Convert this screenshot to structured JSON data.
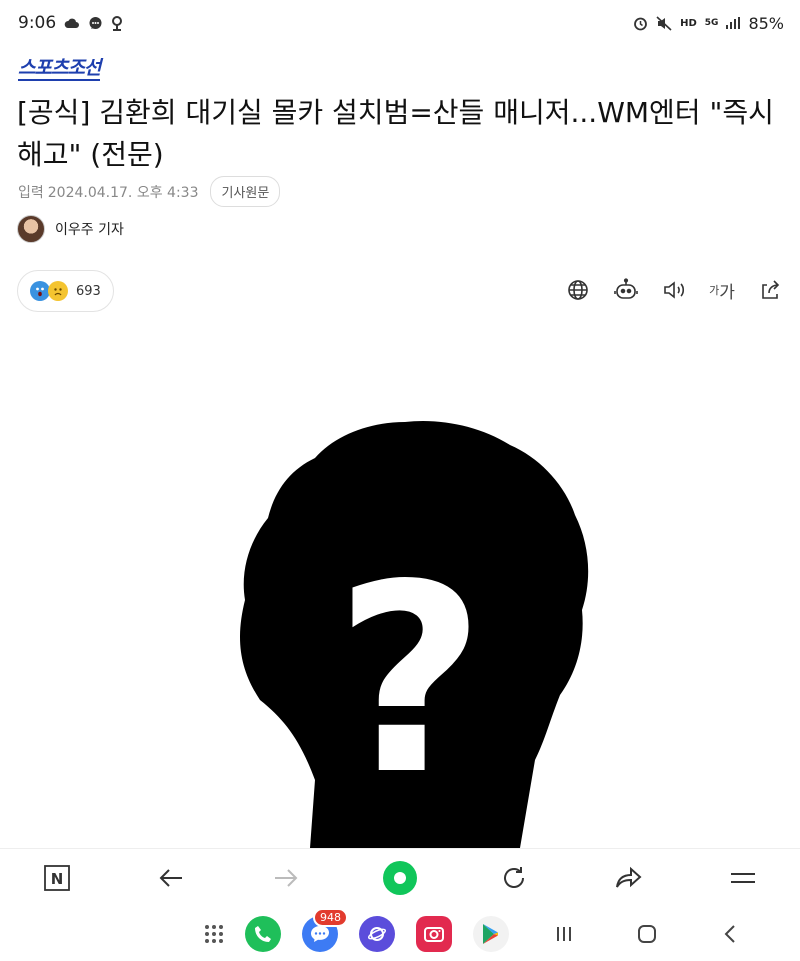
{
  "status": {
    "time": "9:06",
    "network": "HD",
    "network_sub": "5G",
    "battery": "85%",
    "icons": [
      "cloud-icon",
      "chat-icon",
      "pin-icon",
      "alarm-icon",
      "mute-icon",
      "hd-voice-icon",
      "5g-icon",
      "signal-icon"
    ]
  },
  "publisher": {
    "logo_text": "스포츠조선"
  },
  "article": {
    "headline": "[공식] 김환희 대기실 몰카 설치범=산들 매니저...WM엔터 \"즉시 해고\" (전문)",
    "date_label": "입력",
    "date": "2024.04.17. 오후 4:33",
    "origin_button": "기사원문",
    "reporter": "이우주 기자",
    "reaction_count": "693",
    "font_button_small": "가",
    "font_button_large": "가",
    "image_symbol": "?"
  },
  "browser_nav": {
    "items": [
      "naver-icon",
      "back-icon",
      "forward-icon",
      "home-icon",
      "refresh-icon",
      "share-icon",
      "menu-icon"
    ],
    "naver_letter": "N"
  },
  "android_bar": {
    "chat_badge": "948"
  }
}
